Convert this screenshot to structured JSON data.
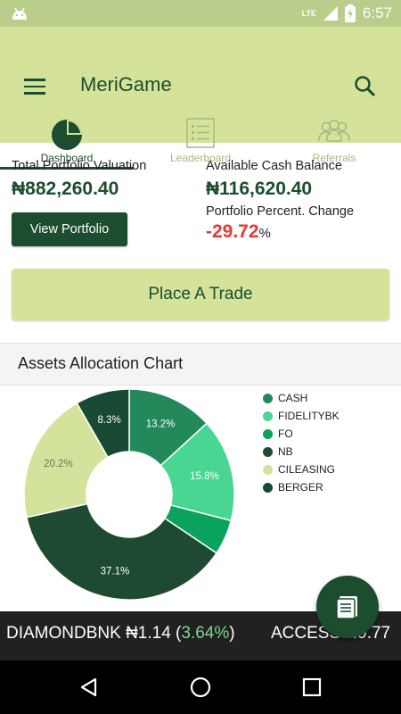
{
  "status_bar": {
    "time": "6:57",
    "network": "LTE"
  },
  "app": {
    "title": "MeriGame"
  },
  "tabs": [
    {
      "label": "Dashboard",
      "active": true
    },
    {
      "label": "Leaderboard",
      "active": false
    },
    {
      "label": "Referrals",
      "active": false
    }
  ],
  "portfolio": {
    "total_label": "Total Portfolio Valuation",
    "total_value": "₦882,260.40",
    "cash_label": "Available Cash Balance",
    "cash_value": "₦116,620.40",
    "change_label": "Portfolio Percent. Change",
    "change_value": "-29.72",
    "change_unit": "%",
    "view_button": "View Portfolio"
  },
  "trade_button": "Place A Trade",
  "chart_section": {
    "title": "Assets Allocation Chart"
  },
  "chart_data": {
    "type": "pie",
    "donut": true,
    "categories": [
      "CASH",
      "FIDELITYBK",
      "FO",
      "NB",
      "CILEASING",
      "BERGER"
    ],
    "values": [
      13.2,
      15.8,
      5.4,
      37.1,
      20.2,
      8.3
    ],
    "labels": [
      "13.2%",
      "15.8%",
      "",
      "37.1%",
      "20.2%",
      "8.3%"
    ],
    "colors": [
      "#23895a",
      "#48d692",
      "#0aa35d",
      "#1f4a32",
      "#d4e39c",
      "#184a33"
    ],
    "legend_position": "right"
  },
  "ticker": {
    "item1_symbol": "DIAMONDBNK",
    "item1_price": "₦1.14",
    "item1_change": "3.64%",
    "item2_text": "ACCESS ₦9.77"
  },
  "icons": {
    "menu": "menu-icon",
    "search": "search-icon",
    "dashboard": "pie-chart-icon",
    "leaderboard": "list-icon",
    "referrals": "people-icon",
    "fab": "document-icon"
  }
}
